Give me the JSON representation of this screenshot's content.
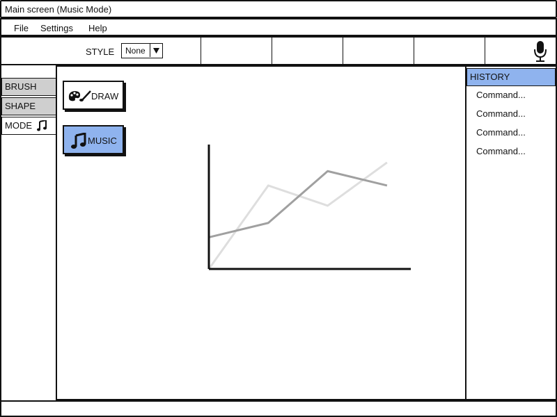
{
  "window": {
    "title": "Main screen (Music Mode)"
  },
  "menu": {
    "items": [
      "File",
      "Settings",
      "Help"
    ]
  },
  "toolbar": {
    "style_label": "STYLE",
    "style_value": "None",
    "mic_icon": "microphone-icon"
  },
  "tabs": {
    "items": [
      "BRUSH",
      "SHAPE",
      "MODE"
    ],
    "selected": "MODE",
    "mode_icon": "music-note-icon"
  },
  "tools": {
    "draw_label": "DRAW",
    "draw_icon": "palette-brush-icon",
    "music_label": "MUSIC",
    "music_icon": "music-note-icon",
    "selected": "MUSIC"
  },
  "history": {
    "title": "HISTORY",
    "items": [
      "Command...",
      "Command...",
      "Command...",
      "Command..."
    ]
  },
  "colors": {
    "selected_blue": "#8fb3ee",
    "tab_gray": "#cfcfcf",
    "line_dark": "#a0a0a0",
    "line_light": "#dedede"
  },
  "chart_data": {
    "type": "line",
    "x": [
      0,
      1,
      2,
      3
    ],
    "series": [
      {
        "values": [
          1.1,
          1.6,
          3.4,
          2.9
        ]
      },
      {
        "values": [
          0,
          2.9,
          2.2,
          3.7
        ]
      }
    ],
    "ylim": [
      0,
      4.3
    ],
    "xlim": [
      0,
      3.4
    ],
    "title": "",
    "xlabel": "",
    "ylabel": ""
  }
}
